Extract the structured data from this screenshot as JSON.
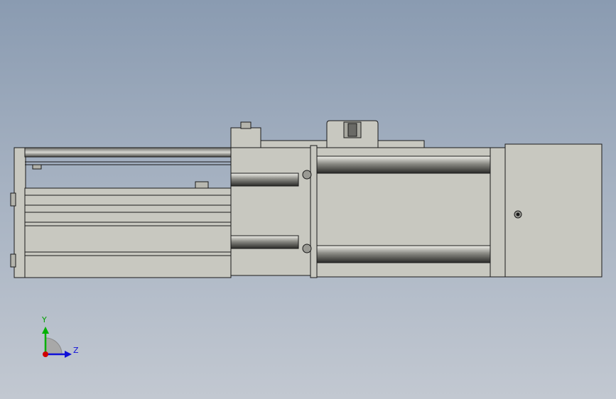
{
  "view": {
    "background_top": "#8a9bb1",
    "background_bottom": "#c2c8d1",
    "part_fill": "#c8c8c0",
    "edge_color": "#1a1a1a"
  },
  "triad": {
    "y_label": "Y",
    "z_label": "Z",
    "y_color": "#00b000",
    "z_color": "#1010d8",
    "x_color": "#d00000"
  }
}
